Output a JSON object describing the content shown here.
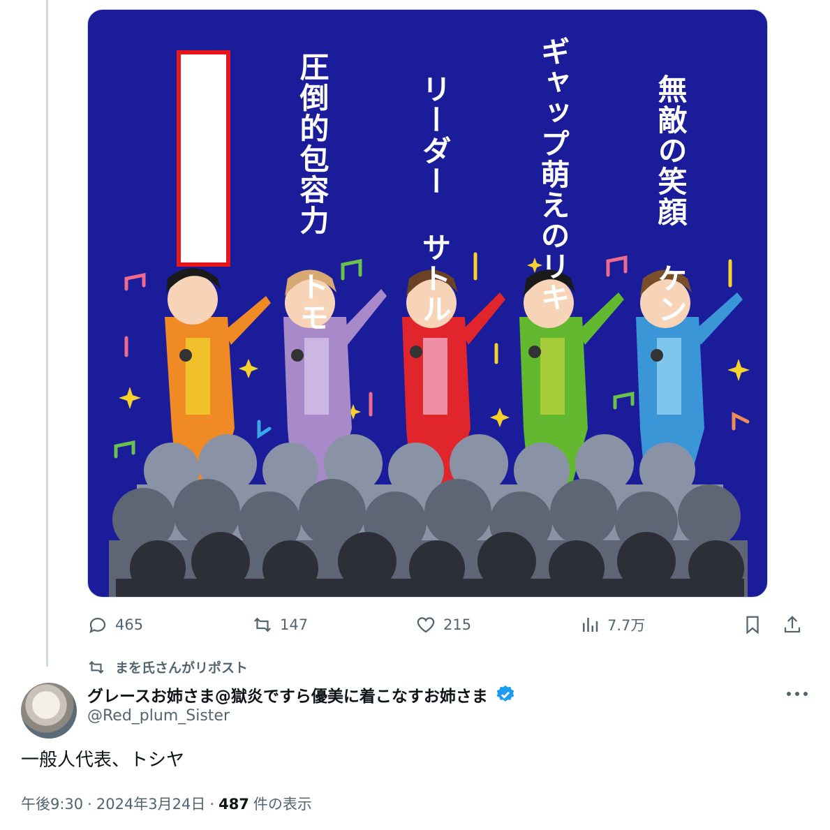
{
  "image_labels": [
    {
      "id": "ken",
      "text": "無敵の笑顔 ケン"
    },
    {
      "id": "riki",
      "text": "ギャップ萌えのリキ"
    },
    {
      "id": "satoru",
      "text": "リーダー サトル"
    },
    {
      "id": "tomo",
      "text": "圧倒的包容力 トモ"
    }
  ],
  "actions": {
    "reply_count": "465",
    "repost_count": "147",
    "like_count": "215",
    "views_count": "7.7万"
  },
  "repost_context": "まを氏さんがリポスト",
  "author": {
    "name": "グレースお姉さま@獄炎ですら優美に着こなすお姉さま",
    "handle": "@Red_plum_Sister"
  },
  "tweet_text": "一般人代表、トシヤ",
  "meta": {
    "time": "午後9:30",
    "sep1": "·",
    "date": "2024年3月24日",
    "sep2": "·",
    "views": "487",
    "views_suffix": "件の表示"
  },
  "colors": {
    "bg_blue": "#1b1c9a",
    "accent": "#1d9bf0",
    "secondary_text": "#536471",
    "card_border": "#e8171c"
  }
}
